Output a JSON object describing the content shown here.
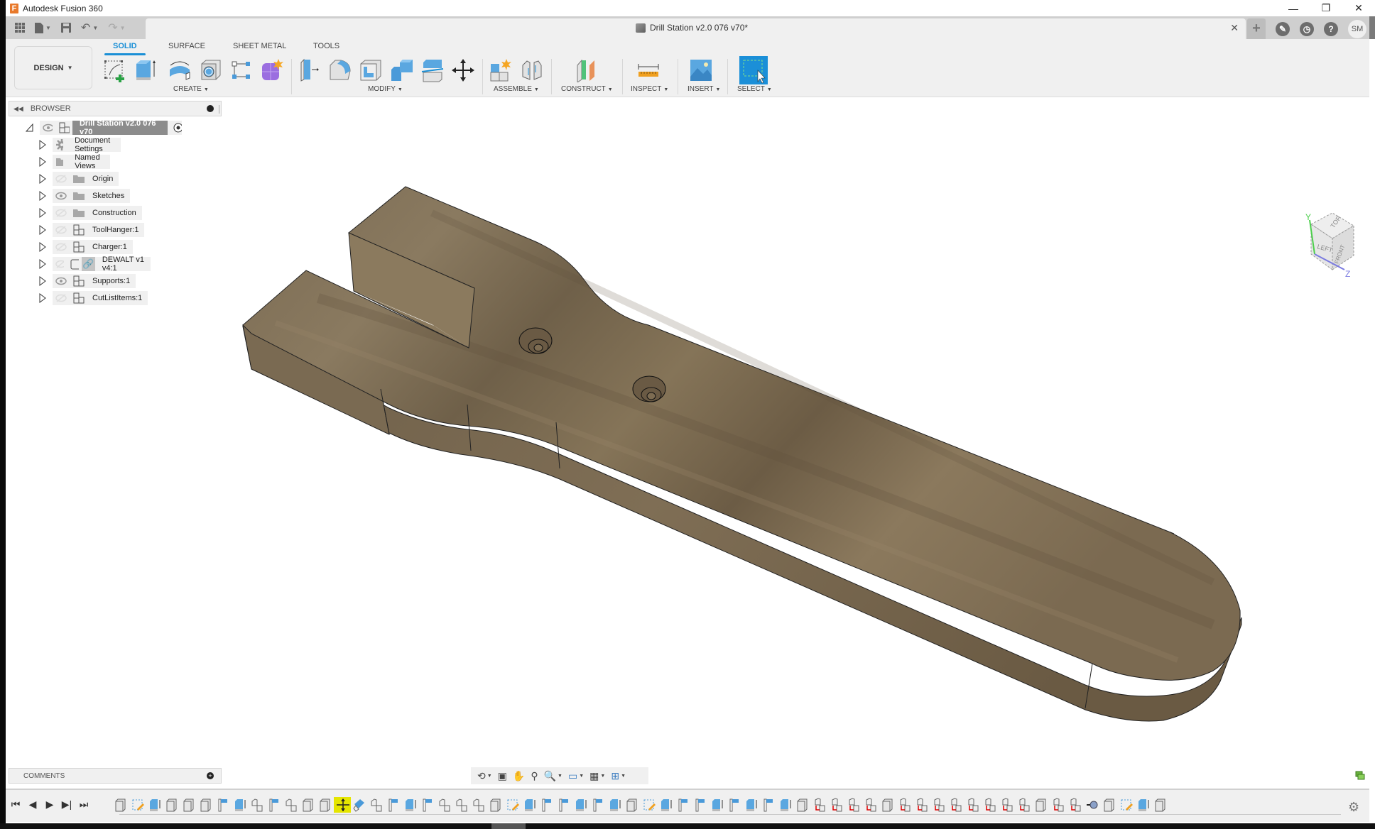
{
  "app": {
    "title": "Autodesk Fusion 360",
    "logo_letter": "F",
    "window_controls": {
      "minimize": "—",
      "restore": "❐",
      "close": "✕"
    }
  },
  "tabbar": {
    "quick_access": [
      {
        "name": "data-panel-icon",
        "glyph": "▦"
      },
      {
        "name": "file-icon",
        "glyph": "▮"
      },
      {
        "name": "save-icon",
        "glyph": "💾"
      },
      {
        "name": "undo-icon",
        "glyph": "↶"
      },
      {
        "name": "redo-icon",
        "glyph": "↷"
      }
    ],
    "document_tab": {
      "title": "Drill Station v2.0 076 v70*",
      "close": "✕"
    },
    "new_tab": "+",
    "right_icons": [
      {
        "name": "extensions-icon",
        "glyph": "✎"
      },
      {
        "name": "job-status-icon",
        "glyph": "◷"
      },
      {
        "name": "help-icon",
        "glyph": "?"
      }
    ],
    "user_initials": "SM"
  },
  "ribbon": {
    "workspace": "DESIGN",
    "tabs": [
      {
        "label": "SOLID",
        "active": true
      },
      {
        "label": "SURFACE",
        "active": false
      },
      {
        "label": "SHEET METAL",
        "active": false
      },
      {
        "label": "TOOLS",
        "active": false
      }
    ],
    "groups": [
      {
        "label": "CREATE",
        "tools": [
          "create-sketch",
          "extrude",
          "revolve",
          "hole",
          "pattern",
          "create-form"
        ]
      },
      {
        "label": "MODIFY",
        "tools": [
          "press-pull",
          "fillet",
          "shell",
          "combine",
          "split-body",
          "move-copy"
        ]
      },
      {
        "label": "ASSEMBLE",
        "tools": [
          "new-component",
          "joint"
        ]
      },
      {
        "label": "CONSTRUCT",
        "tools": [
          "offset-plane"
        ]
      },
      {
        "label": "INSPECT",
        "tools": [
          "measure"
        ]
      },
      {
        "label": "INSERT",
        "tools": [
          "insert-canvas"
        ]
      },
      {
        "label": "SELECT",
        "tools": [
          "select"
        ]
      }
    ]
  },
  "browser": {
    "header": "BROWSER",
    "root": {
      "label": "Drill Station v2.0 076 v70"
    },
    "items": [
      {
        "label": "Document Settings",
        "icon": "gear",
        "visibility": "none"
      },
      {
        "label": "Named Views",
        "icon": "folder",
        "visibility": "none"
      },
      {
        "label": "Origin",
        "icon": "folder",
        "visibility": "hidden"
      },
      {
        "label": "Sketches",
        "icon": "folder",
        "visibility": "visible"
      },
      {
        "label": "Construction",
        "icon": "folder",
        "visibility": "hidden"
      },
      {
        "label": "ToolHanger:1",
        "icon": "component",
        "visibility": "hidden"
      },
      {
        "label": "Charger:1",
        "icon": "component",
        "visibility": "hidden"
      },
      {
        "label": "DEWALT v1 v4:1",
        "icon": "linked-component",
        "visibility": "hidden"
      },
      {
        "label": "Supports:1",
        "icon": "component",
        "visibility": "visible"
      },
      {
        "label": "CutListItems:1",
        "icon": "component",
        "visibility": "hidden"
      }
    ]
  },
  "viewcube": {
    "faces": [
      "TOP",
      "LEFT",
      "FRONT"
    ],
    "axes": [
      "Y",
      "Z"
    ]
  },
  "comments": {
    "header": "COMMENTS"
  },
  "navbar": {
    "tools": [
      "orbit",
      "look-at",
      "pan",
      "zoom",
      "fit",
      "display-settings",
      "grid-snaps",
      "viewports"
    ]
  },
  "timeline": {
    "controls": [
      "first",
      "previous",
      "play",
      "next",
      "last"
    ],
    "items": [
      "body",
      "sketch",
      "extrude",
      "body",
      "body",
      "body",
      "press-pull",
      "extrude",
      "joint",
      "press-pull",
      "joint",
      "body",
      "body",
      "move-selected",
      "split",
      "joint",
      "press-pull",
      "extrude",
      "press-pull",
      "joint",
      "joint",
      "joint",
      "body",
      "sketch",
      "extrude",
      "press-pull",
      "press-pull",
      "extrude",
      "press-pull",
      "extrude",
      "body",
      "sketch",
      "extrude",
      "press-pull",
      "press-pull",
      "extrude",
      "press-pull",
      "extrude",
      "press-pull",
      "extrude",
      "body",
      "joint-red",
      "joint-red",
      "joint-red",
      "joint-red",
      "body",
      "joint-red",
      "joint-red",
      "joint-red",
      "joint-red",
      "joint-red",
      "joint-red",
      "joint-red",
      "joint-red",
      "body",
      "joint-red",
      "joint-red",
      "rigid-group",
      "body",
      "sketch",
      "extrude",
      "body"
    ],
    "selected_index": 13
  },
  "colors": {
    "accent": "#1a8fd6",
    "wood": "#7d6a52",
    "timeline_selected": "#e5e500"
  }
}
